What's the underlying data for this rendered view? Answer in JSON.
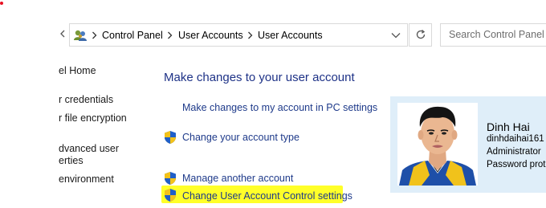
{
  "address_bar": {
    "breadcrumbs": [
      "Control Panel",
      "User Accounts",
      "User Accounts"
    ],
    "search_placeholder": "Search Control Panel"
  },
  "left_pane": {
    "items": [
      {
        "label": "el Home"
      },
      {
        "label": "r credentials"
      },
      {
        "label": "r file encryption"
      },
      {
        "label": "dvanced user"
      },
      {
        "label": "erties"
      },
      {
        "label": "environment"
      }
    ]
  },
  "main": {
    "heading": "Make changes to your user account",
    "tasks": [
      {
        "label": "Make changes to my account in PC settings",
        "icon": "none"
      },
      {
        "label": "Change your account type",
        "icon": "uac-shield-icon"
      },
      {
        "label": "Manage another account",
        "icon": "uac-shield-icon"
      },
      {
        "label": "Change User Account Control settings",
        "icon": "uac-shield-icon",
        "highlighted": true
      }
    ]
  },
  "user": {
    "name": "Dinh Hai",
    "email": "dinhdaihai161",
    "role": "Administrator",
    "password": "Password prot"
  },
  "colors": {
    "link": "#1e3a8a",
    "heading": "#1e3287",
    "highlight": "#ffff29",
    "user_panel_bg": "#dfeef9"
  }
}
